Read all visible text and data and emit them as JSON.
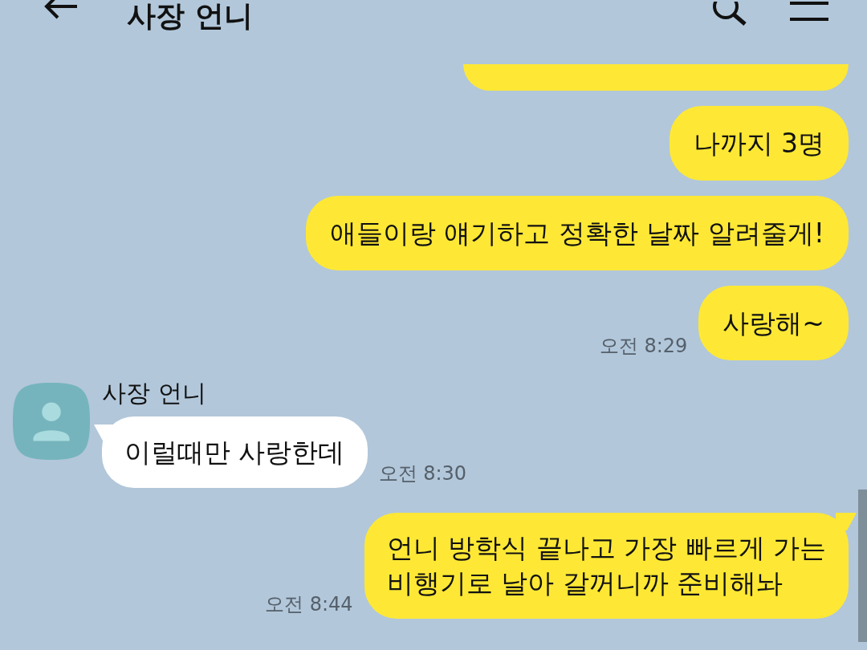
{
  "header": {
    "title": "사장 언니"
  },
  "messages": [
    {
      "kind": "sent_cut"
    },
    {
      "kind": "sent",
      "text": "나까지 3명",
      "tail": false
    },
    {
      "kind": "sent",
      "text": "애들이랑 얘기하고 정확한 날짜 알려줄게!",
      "tail": false
    },
    {
      "kind": "sent",
      "text": "사랑해~",
      "time": "오전 8:29",
      "tail": false
    },
    {
      "kind": "received",
      "sender": "사장 언니",
      "text": "이럴때만 사랑한데",
      "time": "오전 8:30",
      "tail": true
    },
    {
      "kind": "sent",
      "text": "언니 방학식 끝나고 가장 빠르게 가는\n비행기로 날아 갈꺼니까 준비해놔",
      "time": "오전 8:44",
      "tail": true
    }
  ]
}
